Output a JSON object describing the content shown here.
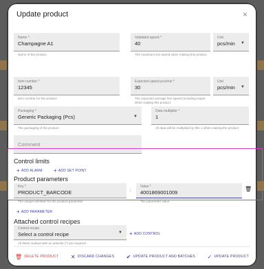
{
  "dialog": {
    "title": "Update product",
    "close_icon": "×"
  },
  "form": {
    "name": {
      "label": "Name *",
      "value": "Champagne A1",
      "helper": "Name of the product"
    },
    "validated_speed": {
      "label": "Validated speed *",
      "value": "40",
      "helper": "The maximum line speed when making this product"
    },
    "unit1": {
      "label": "Unit",
      "value": "pcs/min"
    },
    "item_number": {
      "label": "Item number *",
      "value": "12345",
      "helper": "Item number for the product"
    },
    "expected_speed": {
      "label": "Expected speed pcs/min *",
      "value": "30",
      "helper": "The expected average line speed (including stops) when making this product"
    },
    "unit2": {
      "label": "Unit",
      "value": "pcs/min"
    },
    "packaging": {
      "label": "Packaging *",
      "value": "Generic Packaging (Pcs)",
      "helper": "The packaging of the product"
    },
    "data_multiplier": {
      "label": "Data multiplier *",
      "value": "1",
      "helper": "All data will be multiplied by this 1 when making the product"
    },
    "comment": {
      "placeholder": "Comment"
    }
  },
  "control_limits": {
    "title": "Control limits",
    "add_alarm": "ADD ALARM",
    "add_setpoint": "ADD SET POINT"
  },
  "product_parameters": {
    "title": "Product parameters",
    "key": {
      "label": "Key *",
      "value": "PRODUCT_BARCODE",
      "helper": "The unique identifier for the product parameter"
    },
    "separator": ":",
    "value": {
      "label": "Value *",
      "value": "4001869001009",
      "helper": "The parameter value"
    },
    "add_parameter": "ADD PARAMETER"
  },
  "control_recipes": {
    "title": "Attached control recipes",
    "select": {
      "label": "Control recipe",
      "value": "Select a control recipe"
    },
    "add_control": "ADD CONTROL",
    "required_note": "All fields marked with an asterisk (*) are required."
  },
  "footer": {
    "delete": "DELETE PRODUCT",
    "discard": "DISCARD CHANGES",
    "update_batches": "UPDATE PRODUCT AND BATCHES",
    "update": "UPDATE PRODUCT"
  },
  "colors": {
    "accent": "#3a3d9a",
    "danger": "#d23a3a",
    "highlight": "#d63bc8",
    "field_bg": "#ececec"
  }
}
